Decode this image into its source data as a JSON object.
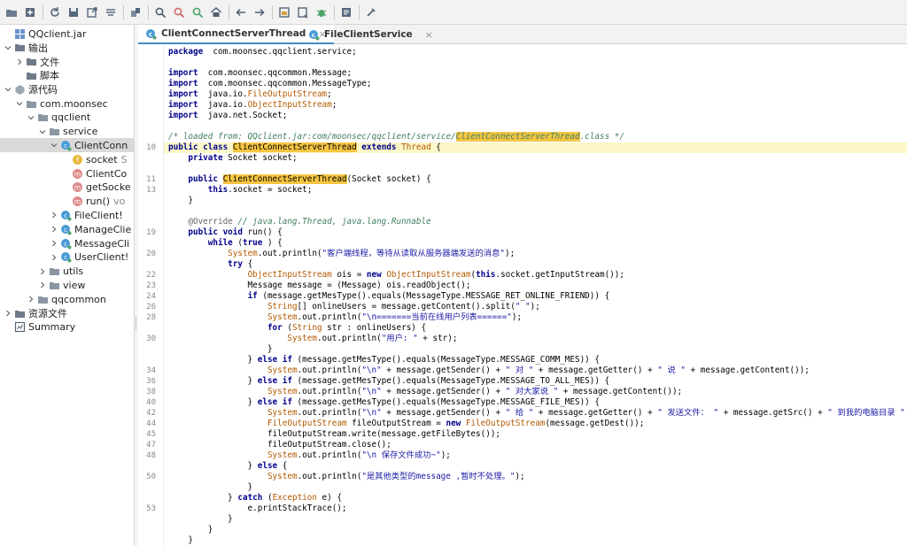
{
  "toolbar": {
    "buttons": [
      "open-icon",
      "export-icon",
      "refresh-icon",
      "save-icon",
      "export-code-icon",
      "flatten-icon",
      "package-icon",
      "search-icon",
      "find-usage-icon",
      "find-class-icon",
      "home-icon",
      "back-icon",
      "forward-icon",
      "deobfuscation-icon",
      "decompile-icon",
      "debug-icon",
      "log-icon",
      "settings-icon"
    ]
  },
  "tree": {
    "items": [
      {
        "label": "QQclient.jar",
        "sub": "",
        "indent": 0,
        "chevron": "",
        "icon": "jar"
      },
      {
        "label": "输出",
        "sub": "",
        "indent": 0,
        "chevron": "down",
        "icon": "folder"
      },
      {
        "label": "文件",
        "sub": "",
        "indent": 1,
        "chevron": "right",
        "icon": "folder"
      },
      {
        "label": "脚本",
        "sub": "",
        "indent": 1,
        "chevron": "",
        "icon": "folder"
      },
      {
        "label": "源代码",
        "sub": "",
        "indent": 0,
        "chevron": "down",
        "icon": "source"
      },
      {
        "label": "com.moonsec",
        "sub": "",
        "indent": 1,
        "chevron": "down",
        "icon": "package"
      },
      {
        "label": "qqclient",
        "sub": "",
        "indent": 2,
        "chevron": "down",
        "icon": "package"
      },
      {
        "label": "service",
        "sub": "",
        "indent": 3,
        "chevron": "down",
        "icon": "package"
      },
      {
        "label": "ClientConn",
        "sub": "",
        "indent": 4,
        "chevron": "down",
        "icon": "class",
        "selected": true
      },
      {
        "label": "socket",
        "sub": "S",
        "indent": 5,
        "chevron": "",
        "icon": "field"
      },
      {
        "label": "ClientCo",
        "sub": "",
        "indent": 5,
        "chevron": "",
        "icon": "method"
      },
      {
        "label": "getSocke",
        "sub": "",
        "indent": 5,
        "chevron": "",
        "icon": "method"
      },
      {
        "label": "run()",
        "sub": "vo",
        "indent": 5,
        "chevron": "",
        "icon": "method"
      },
      {
        "label": "FileClient!",
        "sub": "",
        "indent": 4,
        "chevron": "right",
        "icon": "class"
      },
      {
        "label": "ManageClie",
        "sub": "",
        "indent": 4,
        "chevron": "right",
        "icon": "class"
      },
      {
        "label": "MessageCli",
        "sub": "",
        "indent": 4,
        "chevron": "right",
        "icon": "class"
      },
      {
        "label": "UserClient!",
        "sub": "",
        "indent": 4,
        "chevron": "right",
        "icon": "class"
      },
      {
        "label": "utils",
        "sub": "",
        "indent": 3,
        "chevron": "right",
        "icon": "package"
      },
      {
        "label": "view",
        "sub": "",
        "indent": 3,
        "chevron": "right",
        "icon": "package"
      },
      {
        "label": "qqcommon",
        "sub": "",
        "indent": 2,
        "chevron": "right",
        "icon": "package"
      },
      {
        "label": "资源文件",
        "sub": "",
        "indent": 0,
        "chevron": "right",
        "icon": "resources"
      },
      {
        "label": "Summary",
        "sub": "",
        "indent": 0,
        "chevron": "",
        "icon": "summary"
      }
    ]
  },
  "tabs": [
    {
      "label": "ClientConnectServerThread",
      "close": "×",
      "active": true
    },
    {
      "label": "FileClientService",
      "close": "×",
      "active": false
    }
  ],
  "editor": {
    "highlight_line": 9,
    "lines": [
      {
        "n": "",
        "code": [
          [
            "kw",
            "package"
          ],
          [
            "",
            "  com.moonsec.qqclient.service;"
          ]
        ]
      },
      {
        "n": "",
        "code": []
      },
      {
        "n": "",
        "code": [
          [
            "kw",
            "import"
          ],
          [
            "",
            "  com.moonsec.qqcommon.Message;"
          ]
        ]
      },
      {
        "n": "",
        "code": [
          [
            "kw",
            "import"
          ],
          [
            "",
            "  com.moonsec.qqcommon.MessageType;"
          ]
        ]
      },
      {
        "n": "",
        "code": [
          [
            "kw",
            "import"
          ],
          [
            "",
            "  java.io."
          ],
          [
            "ty",
            "FileOutputStream"
          ],
          [
            "",
            ";"
          ]
        ]
      },
      {
        "n": "",
        "code": [
          [
            "kw",
            "import"
          ],
          [
            "",
            "  java.io."
          ],
          [
            "ty",
            "ObjectInputStream"
          ],
          [
            "",
            ";"
          ]
        ]
      },
      {
        "n": "",
        "code": [
          [
            "kw",
            "import"
          ],
          [
            "",
            "  java.net.Socket;"
          ]
        ]
      },
      {
        "n": "",
        "code": []
      },
      {
        "n": "",
        "code": [
          [
            "cm",
            "/* loaded from: QQclient.jar:com/moonsec/qqclient/service/"
          ],
          [
            "mark-cm",
            "ClientConnectServerThread"
          ],
          [
            "cm",
            ".class */"
          ]
        ]
      },
      {
        "n": "10",
        "code": [
          [
            "kw",
            "public class "
          ],
          [
            "mark",
            "ClientConnectServerThread"
          ],
          [
            "kw",
            " extends "
          ],
          [
            "ty",
            "Thread"
          ],
          [
            "",
            " {"
          ]
        ]
      },
      {
        "n": "",
        "code": [
          [
            "",
            "    "
          ],
          [
            "kw",
            "private"
          ],
          [
            "",
            " Socket socket;"
          ]
        ]
      },
      {
        "n": "",
        "code": []
      },
      {
        "n": "11",
        "code": [
          [
            "",
            "    "
          ],
          [
            "kw",
            "public "
          ],
          [
            "mark",
            "ClientConnectServerThread"
          ],
          [
            "",
            "(Socket socket) {"
          ]
        ]
      },
      {
        "n": "13",
        "code": [
          [
            "",
            "        "
          ],
          [
            "kw",
            "this"
          ],
          [
            "",
            ".socket = socket;"
          ]
        ]
      },
      {
        "n": "",
        "code": [
          [
            "",
            "    }"
          ]
        ]
      },
      {
        "n": "",
        "code": []
      },
      {
        "n": "",
        "code": [
          [
            "",
            "    "
          ],
          [
            "an",
            "@Override"
          ],
          [
            "cm",
            " // java.lang.Thread, java.lang.Runnable"
          ]
        ]
      },
      {
        "n": "19",
        "code": [
          [
            "",
            "    "
          ],
          [
            "kw",
            "public void"
          ],
          [
            "",
            " run() {"
          ]
        ]
      },
      {
        "n": "",
        "code": [
          [
            "",
            "        "
          ],
          [
            "kw",
            "while"
          ],
          [
            "",
            " ("
          ],
          [
            "kw",
            "true"
          ],
          [
            "",
            " ) {"
          ]
        ]
      },
      {
        "n": "20",
        "code": [
          [
            "",
            "            "
          ],
          [
            "ty",
            "System"
          ],
          [
            "",
            ".out.println("
          ],
          [
            "str",
            "\"客户端线程，等待从读取从服务器端发送的消息\""
          ],
          [
            "",
            ");"
          ]
        ]
      },
      {
        "n": "",
        "code": [
          [
            "",
            "            "
          ],
          [
            "kw",
            "try"
          ],
          [
            "",
            " {"
          ]
        ]
      },
      {
        "n": "22",
        "code": [
          [
            "",
            "                "
          ],
          [
            "ty",
            "ObjectInputStream"
          ],
          [
            "",
            " ois = "
          ],
          [
            "kw",
            "new"
          ],
          [
            " ",
            " "
          ],
          [
            "ty",
            "ObjectInputStream"
          ],
          [
            "",
            "("
          ],
          [
            "kw",
            "this"
          ],
          [
            "",
            ".socket.getInputStream());"
          ]
        ]
      },
      {
        "n": "23",
        "code": [
          [
            "",
            "                Message message = (Message) ois.readObject();"
          ]
        ]
      },
      {
        "n": "24",
        "code": [
          [
            "",
            "                "
          ],
          [
            "kw",
            "if"
          ],
          [
            "",
            " (message.getMesType().equals(MessageType.MESSAGE_RET_ONLINE_FRIEND)) {"
          ]
        ]
      },
      {
        "n": "26",
        "code": [
          [
            "",
            "                    "
          ],
          [
            "ty",
            "String"
          ],
          [
            "",
            "[] onlineUsers = message.getContent().split("
          ],
          [
            "str",
            "\" \""
          ],
          [
            "",
            ");"
          ]
        ]
      },
      {
        "n": "28",
        "code": [
          [
            "",
            "                    "
          ],
          [
            "ty",
            "System"
          ],
          [
            "",
            ".out.println("
          ],
          [
            "str",
            "\"\\n=======当前在线用户列表======\""
          ],
          [
            "",
            ");"
          ]
        ]
      },
      {
        "n": "",
        "code": [
          [
            "",
            "                    "
          ],
          [
            "kw",
            "for"
          ],
          [
            "",
            " ("
          ],
          [
            "ty",
            "String"
          ],
          [
            "",
            " str : onlineUsers) {"
          ]
        ]
      },
      {
        "n": "30",
        "code": [
          [
            "",
            "                        "
          ],
          [
            "ty",
            "System"
          ],
          [
            "",
            ".out.println("
          ],
          [
            "str",
            "\"用户: \""
          ],
          [
            "",
            " + str);"
          ]
        ]
      },
      {
        "n": "",
        "code": [
          [
            "",
            "                    }"
          ]
        ]
      },
      {
        "n": "",
        "code": [
          [
            "",
            "                } "
          ],
          [
            "kw",
            "else if"
          ],
          [
            "",
            " (message.getMesType().equals(MessageType.MESSAGE_COMM_MES)) {"
          ]
        ]
      },
      {
        "n": "34",
        "code": [
          [
            "",
            "                    "
          ],
          [
            "ty",
            "System"
          ],
          [
            "",
            ".out.println("
          ],
          [
            "str",
            "\"\\n\""
          ],
          [
            "",
            " + message.getSender() + "
          ],
          [
            "str",
            "\" 对 \""
          ],
          [
            "",
            " + message.getGetter() + "
          ],
          [
            "str",
            "\" 说 \""
          ],
          [
            "",
            " + message.getContent());"
          ]
        ]
      },
      {
        "n": "36",
        "code": [
          [
            "",
            "                } "
          ],
          [
            "kw",
            "else if"
          ],
          [
            "",
            " (message.getMesType().equals(MessageType.MESSAGE_TO_ALL_MES)) {"
          ]
        ]
      },
      {
        "n": "38",
        "code": [
          [
            "",
            "                    "
          ],
          [
            "ty",
            "System"
          ],
          [
            "",
            ".out.println("
          ],
          [
            "str",
            "\"\\n\""
          ],
          [
            "",
            " + message.getSender() + "
          ],
          [
            "str",
            "\" 对大家说 \""
          ],
          [
            "",
            " + message.getContent());"
          ]
        ]
      },
      {
        "n": "40",
        "code": [
          [
            "",
            "                } "
          ],
          [
            "kw",
            "else if"
          ],
          [
            "",
            " (message.getMesType().equals(MessageType.MESSAGE_FILE_MES)) {"
          ]
        ]
      },
      {
        "n": "42",
        "code": [
          [
            "",
            "                    "
          ],
          [
            "ty",
            "System"
          ],
          [
            "",
            ".out.println("
          ],
          [
            "str",
            "\"\\n\""
          ],
          [
            "",
            " + message.getSender() + "
          ],
          [
            "str",
            "\" 给 \""
          ],
          [
            "",
            " + message.getGetter() + "
          ],
          [
            "str",
            "\" 发送文件： \""
          ],
          [
            "",
            " + message.getSrc() + "
          ],
          [
            "str",
            "\" 到我的电脑目录 \""
          ],
          [
            "",
            " + mess"
          ]
        ]
      },
      {
        "n": "44",
        "code": [
          [
            "",
            "                    "
          ],
          [
            "ty",
            "FileOutputStream"
          ],
          [
            "",
            " fileOutputStream = "
          ],
          [
            "kw",
            "new"
          ],
          [
            " ",
            " "
          ],
          [
            "ty",
            "FileOutputStream"
          ],
          [
            "",
            "(message.getDest());"
          ]
        ]
      },
      {
        "n": "45",
        "code": [
          [
            "",
            "                    fileOutputStream.write(message.getFileBytes());"
          ]
        ]
      },
      {
        "n": "47",
        "code": [
          [
            "",
            "                    fileOutputStream.close();"
          ]
        ]
      },
      {
        "n": "48",
        "code": [
          [
            "",
            "                    "
          ],
          [
            "ty",
            "System"
          ],
          [
            "",
            ".out.println("
          ],
          [
            "str",
            "\"\\n 保存文件成功~\""
          ],
          [
            "",
            ");"
          ]
        ]
      },
      {
        "n": "",
        "code": [
          [
            "",
            "                } "
          ],
          [
            "kw",
            "else"
          ],
          [
            "",
            " {"
          ]
        ]
      },
      {
        "n": "50",
        "code": [
          [
            "",
            "                    "
          ],
          [
            "ty",
            "System"
          ],
          [
            "",
            ".out.println("
          ],
          [
            "str",
            "\"是其他类型的message ,暂时不处理。\""
          ],
          [
            "",
            ");"
          ]
        ]
      },
      {
        "n": "",
        "code": [
          [
            "",
            "                }"
          ]
        ]
      },
      {
        "n": "",
        "code": [
          [
            "",
            "            } "
          ],
          [
            "kw",
            "catch"
          ],
          [
            "",
            " ("
          ],
          [
            "ty",
            "Exception"
          ],
          [
            "",
            " e) {"
          ]
        ]
      },
      {
        "n": "53",
        "code": [
          [
            "",
            "                e.printStackTrace();"
          ]
        ]
      },
      {
        "n": "",
        "code": [
          [
            "",
            "            }"
          ]
        ]
      },
      {
        "n": "",
        "code": [
          [
            "",
            "        }"
          ]
        ]
      },
      {
        "n": "",
        "code": [
          [
            "",
            "    }"
          ]
        ]
      }
    ]
  },
  "colors": {
    "selection": "#d9d9d9",
    "keyword": "#00008b",
    "comment": "#3f7f5f",
    "highlight": "#f5c542",
    "line_highlight": "#fbf7c8"
  }
}
